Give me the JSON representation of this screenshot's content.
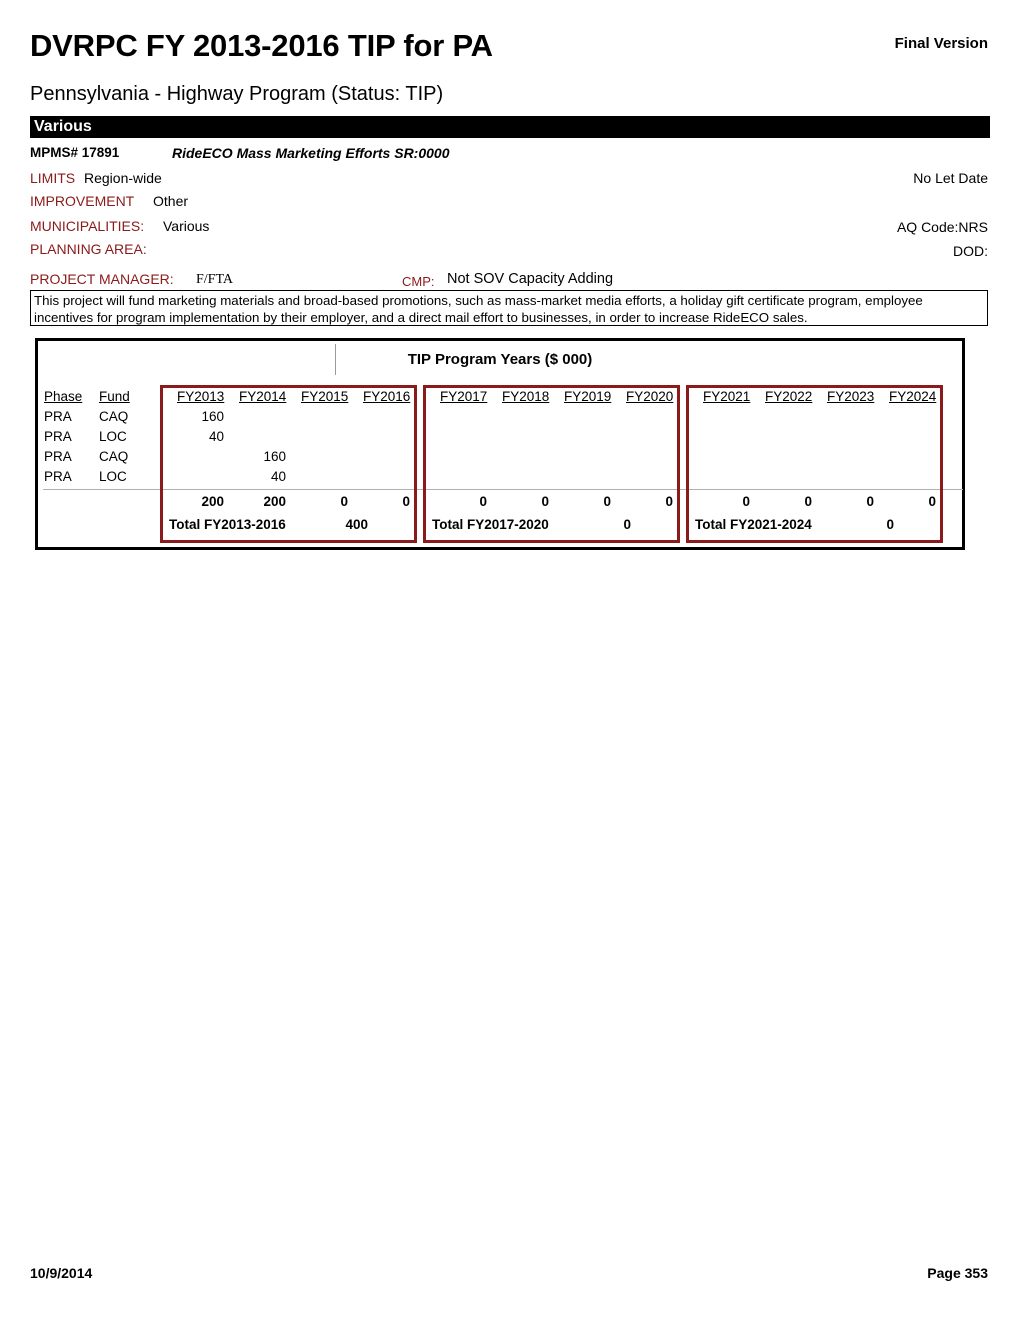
{
  "header": {
    "title": "DVRPC FY 2013-2016 TIP for PA",
    "version": "Final Version",
    "subtitle": "Pennsylvania - Highway Program (Status: TIP)",
    "section_bar": "Various"
  },
  "project": {
    "mpms_label": "MPMS#  17891",
    "title": "RideECO Mass Marketing Efforts SR:0000"
  },
  "meta": {
    "limits_label": "LIMITS",
    "limits_value": "Region-wide",
    "improvement_label": "IMPROVEMENT",
    "improvement_value": "Other",
    "municipalities_label": "MUNICIPALITIES:",
    "municipalities_value": "Various",
    "planning_area_label": "PLANNING AREA:",
    "planning_area_value": "",
    "project_manager_label": "PROJECT MANAGER:",
    "project_manager_value": "F/FTA",
    "cmp_label": "CMP:",
    "cmp_value": "Not SOV Capacity Adding",
    "let_date": "No Let Date",
    "aq_code": "AQ Code:NRS",
    "dod": "DOD:"
  },
  "description": "This project will fund marketing materials and broad-based promotions, such as mass-market media efforts, a holiday gift certificate program, employee incentives for program implementation by their employer, and a direct mail effort to businesses, in order to increase RideECO sales.",
  "table": {
    "title": "TIP Program Years ($ 000)",
    "phase_header": "Phase",
    "fund_header": "Fund",
    "rows": [
      {
        "phase": "PRA",
        "fund": "CAQ"
      },
      {
        "phase": "PRA",
        "fund": "LOC"
      },
      {
        "phase": "PRA",
        "fund": "CAQ"
      },
      {
        "phase": "PRA",
        "fund": "LOC"
      }
    ],
    "groups": [
      {
        "years": [
          "FY2013",
          "FY2014",
          "FY2015",
          "FY2016"
        ],
        "values": [
          [
            "160",
            "",
            "",
            ""
          ],
          [
            "40",
            "",
            "",
            ""
          ],
          [
            "",
            "160",
            "",
            ""
          ],
          [
            "",
            "40",
            "",
            ""
          ]
        ],
        "year_totals": [
          "200",
          "200",
          "0",
          "0"
        ],
        "total_label": "Total FY2013-2016",
        "total_value": "400"
      },
      {
        "years": [
          "FY2017",
          "FY2018",
          "FY2019",
          "FY2020"
        ],
        "values": [
          [
            "",
            "",
            "",
            ""
          ],
          [
            "",
            "",
            "",
            ""
          ],
          [
            "",
            "",
            "",
            ""
          ],
          [
            "",
            "",
            "",
            ""
          ]
        ],
        "year_totals": [
          "0",
          "0",
          "0",
          "0"
        ],
        "total_label": "Total FY2017-2020",
        "total_value": "0"
      },
      {
        "years": [
          "FY2021",
          "FY2022",
          "FY2023",
          "FY2024"
        ],
        "values": [
          [
            "",
            "",
            "",
            ""
          ],
          [
            "",
            "",
            "",
            ""
          ],
          [
            "",
            "",
            "",
            ""
          ],
          [
            "",
            "",
            "",
            ""
          ]
        ],
        "year_totals": [
          "0",
          "0",
          "0",
          "0"
        ],
        "total_label": "Total FY2021-2024",
        "total_value": "0"
      }
    ]
  },
  "footer": {
    "date": "10/9/2014",
    "page": "Page 353"
  },
  "colors": {
    "label_maroon": "#8B1A1A",
    "group_border": "#8B1A1A",
    "bar_black": "#000000"
  }
}
